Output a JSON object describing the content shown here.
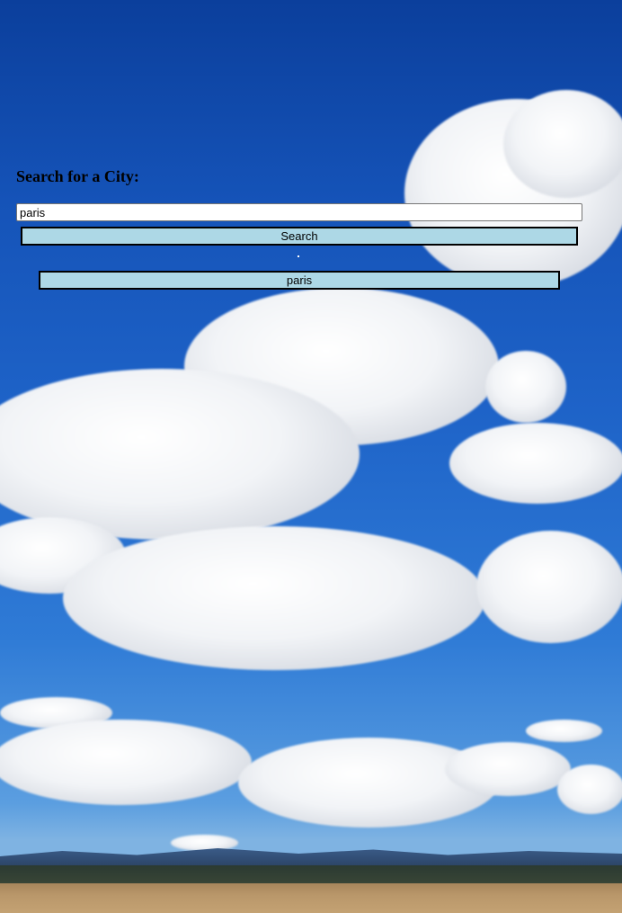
{
  "page": {
    "heading": "Search for a City:",
    "search": {
      "value": "paris",
      "placeholder": ""
    },
    "search_button_label": "Search",
    "results": [
      {
        "label": "paris"
      }
    ]
  },
  "colors": {
    "button_background": "#add8e6",
    "button_border": "#000000",
    "sky_top": "#0b3f9c",
    "sky_bottom": "#7fb3e2"
  },
  "icons": {
    "background": "sky-clouds-background-image"
  }
}
